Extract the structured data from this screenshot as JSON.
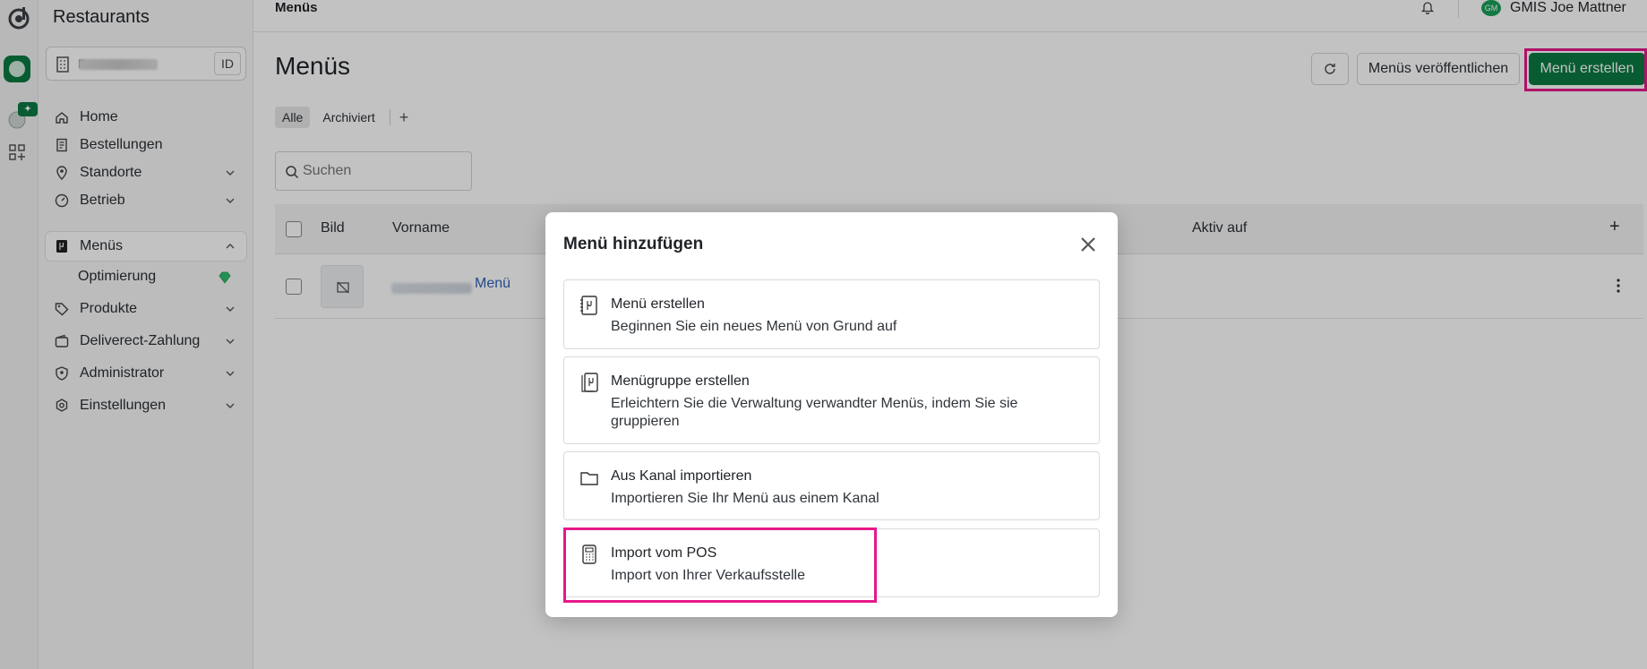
{
  "rail": {
    "badge_icon": "sparkle-plus-icon"
  },
  "sidebar": {
    "title": "Restaurants",
    "account": {
      "name_visible": "B",
      "id_label": "ID"
    },
    "items": [
      {
        "label": "Home",
        "icon": "home-icon"
      },
      {
        "label": "Bestellungen",
        "icon": "receipt-icon"
      },
      {
        "label": "Standorte",
        "icon": "location-pin-icon"
      },
      {
        "label": "Betrieb",
        "icon": "gauge-icon"
      },
      {
        "label": "Menüs",
        "icon": "menu-book-icon"
      },
      {
        "label": "Optimierung",
        "icon": "diamond-icon"
      },
      {
        "label": "Produkte",
        "icon": "tag-icon"
      },
      {
        "label": "Deliverect-Zahlung",
        "icon": "wallet-icon"
      },
      {
        "label": "Administrator",
        "icon": "admin-shield-icon"
      },
      {
        "label": "Einstellungen",
        "icon": "gear-icon"
      }
    ]
  },
  "topbar": {
    "breadcrumb": "Menüs",
    "avatar_initials": "GM",
    "user_name": "GMIS Joe Mattner"
  },
  "main": {
    "title": "Menüs",
    "buttons": {
      "publish": "Menüs veröffentlichen",
      "create": "Menü erstellen"
    },
    "tabs": [
      "Alle",
      "Archiviert"
    ],
    "tab_add": "+",
    "search_placeholder": "Suchen",
    "table": {
      "headers": [
        "Bild",
        "Vorname",
        "Aktiv auf"
      ],
      "add_col": "+",
      "rows": [
        {
          "name_suffix": "Menü"
        }
      ]
    }
  },
  "modal": {
    "title": "Menü hinzufügen",
    "options": [
      {
        "title": "Menü erstellen",
        "desc": "Beginnen Sie ein neues Menü von Grund auf",
        "icon": "menu-book-icon"
      },
      {
        "title": "Menügruppe erstellen",
        "desc": "Erleichtern Sie die Verwaltung verwandter Menüs, indem Sie sie gruppieren",
        "icon": "menu-group-icon"
      },
      {
        "title": "Aus Kanal importieren",
        "desc": "Importieren Sie Ihr Menü aus einem Kanal",
        "icon": "folder-icon"
      },
      {
        "title": "Import vom POS",
        "desc": "Import von Ihrer Verkaufsstelle",
        "icon": "calculator-icon"
      }
    ]
  },
  "colors": {
    "brand_green": "#0b7a42",
    "highlight_pink": "#e6188a",
    "link_blue": "#2e62b8"
  }
}
